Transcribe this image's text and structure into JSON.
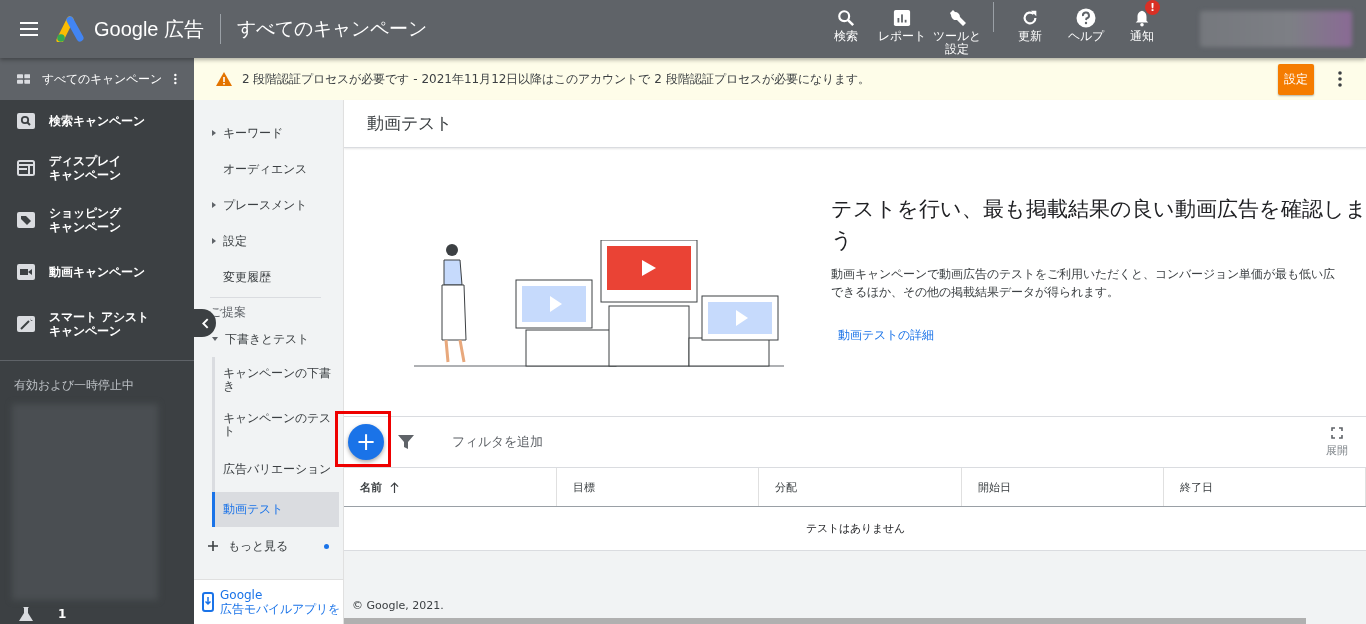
{
  "header": {
    "brand": "Google 広告",
    "page_title": "すべてのキャンペーン",
    "tools": [
      {
        "kind": "search",
        "label": "検索"
      },
      {
        "kind": "report",
        "label": "レポート"
      },
      {
        "kind": "tools",
        "label": "ツールと設定"
      },
      {
        "kind": "refresh",
        "label": "更新"
      },
      {
        "kind": "help",
        "label": "ヘルプ"
      },
      {
        "kind": "bell",
        "label": "通知",
        "badge": "!"
      }
    ]
  },
  "campaign_nav": {
    "header": "すべてのキャンペーン",
    "items": [
      {
        "kind": "search",
        "label": [
          "検索キャンペーン"
        ]
      },
      {
        "kind": "display",
        "label": [
          "ディスプレイ",
          "キャンペーン"
        ]
      },
      {
        "kind": "shopping",
        "label": [
          "ショッピング",
          "キャンペーン"
        ]
      },
      {
        "kind": "video",
        "label": [
          "動画キャンペーン"
        ]
      },
      {
        "kind": "smart",
        "label": [
          "スマート アシスト",
          "キャンペーン"
        ]
      }
    ],
    "section": "有効および一時停止中",
    "experiment_count": "1"
  },
  "banner": {
    "message": "2 段階認証プロセスが必要です - 2021年11月12日以降はこのアカウントで 2 段階認証プロセスが必要になります。",
    "button": "設定"
  },
  "page_nav": {
    "items": [
      {
        "label": "キーワード",
        "expandable": true
      },
      {
        "label": "オーディエンス",
        "expandable": false
      },
      {
        "label": "プレースメント",
        "expandable": true
      },
      {
        "label": "設定",
        "expandable": true
      },
      {
        "label": "変更履歴",
        "expandable": false
      }
    ],
    "section": "ご提案",
    "group": {
      "label": "下書きとテスト",
      "expanded": true,
      "children": [
        {
          "label": "キャンペーンの下書き",
          "selected": false
        },
        {
          "label": "キャンペーンのテスト",
          "selected": false
        },
        {
          "label": "広告バリエーション",
          "selected": false
        },
        {
          "label": "動画テスト",
          "selected": true
        }
      ]
    },
    "more": {
      "label": "もっと見る",
      "new": true
    },
    "promo": [
      "Google",
      "広告モバイルアプリを"
    ]
  },
  "main": {
    "title": "動画テスト",
    "hero": {
      "heading": [
        "テストを行い、最も掲載結果の良い動画広告を確認しま",
        "う"
      ],
      "body": [
        "動画キャンペーンで動画広告のテストをご利用いただくと、コンバージョン単価が最も低い広",
        "できるほか、その他の掲載結果データが得られます。"
      ],
      "link": "動画テストの詳細"
    },
    "toolbar": {
      "add": "+",
      "filter": "フィルタを追加",
      "expand": "展開",
      "highlighted": true
    },
    "table": {
      "columns": [
        {
          "label": "名前",
          "sorted": true
        },
        {
          "label": "目標",
          "sorted": false
        },
        {
          "label": "分配",
          "sorted": false
        },
        {
          "label": "開始日",
          "sorted": false
        },
        {
          "label": "終了日",
          "sorted": false
        }
      ],
      "empty": "テストはありません"
    },
    "footer": "© Google, 2021."
  }
}
